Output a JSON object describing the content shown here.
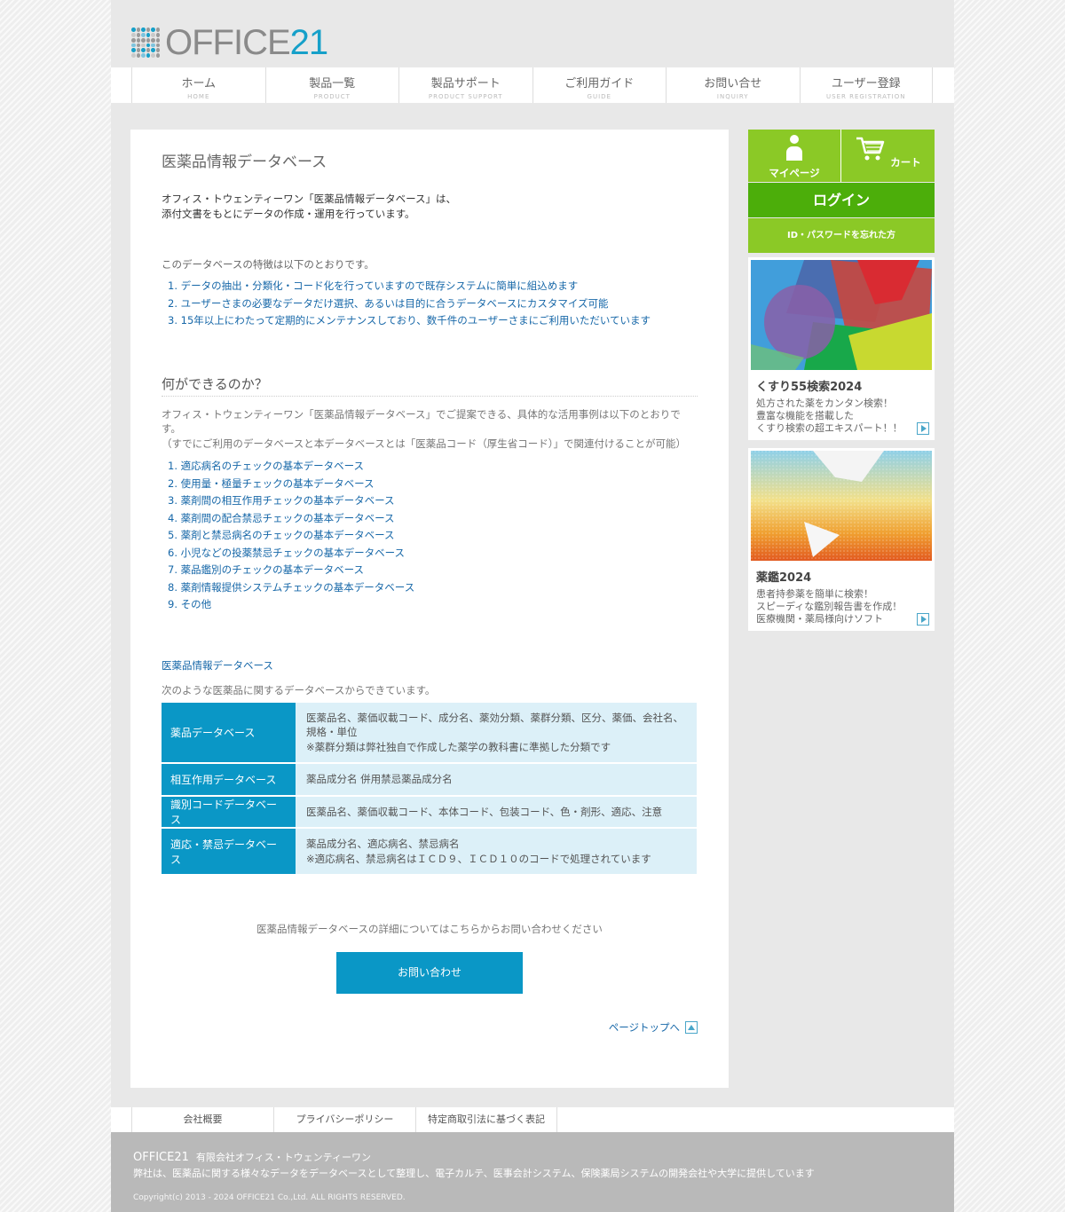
{
  "header": {
    "logo": {
      "text": "OFFICE",
      "num": "21"
    }
  },
  "nav": [
    {
      "label": "ホーム",
      "sub": "HOME"
    },
    {
      "label": "製品一覧",
      "sub": "PRODUCT"
    },
    {
      "label": "製品サポート",
      "sub": "PRODUCT SUPPORT"
    },
    {
      "label": "ご利用ガイド",
      "sub": "GUIDE"
    },
    {
      "label": "お問い合せ",
      "sub": "INQUIRY"
    },
    {
      "label": "ユーザー登録",
      "sub": "USER REGISTRATION"
    }
  ],
  "main": {
    "title": "医薬品情報データベース",
    "intro_line1": "オフィス・トウェンティーワン「医薬品情報データベース」は、",
    "intro_line2": "添付文書をもとにデータの作成・運用を行っています。",
    "features_lead": "このデータベースの特徴は以下のとおりです。",
    "features": [
      "1. データの抽出・分類化・コード化を行っていますので既存システムに簡単に組込めます",
      "2. ユーザーさまの必要なデータだけ選択、あるいは目的に合うデータベースにカスタマイズ可能",
      "3. 15年以上にわたって定期的にメンテナンスしており、数千件のユーザーさまにご利用いただいています"
    ],
    "can_title": "何ができるのか？",
    "can_desc1": "オフィス・トウェンティーワン「医薬品情報データベース」でご提案できる、具体的な活用事例は以下のとおりです。",
    "can_desc2": "（すでにご利用のデータベースと本データベースとは「医薬品コード（厚生省コード）」で関連付けることが可能）",
    "uses": [
      "1. 適応病名のチェックの基本データベース",
      "2. 使用量・極量チェックの基本データベース",
      "3. 薬剤間の相互作用チェックの基本データベース",
      "4. 薬剤間の配合禁忌チェックの基本データベース",
      "5. 薬剤と禁忌病名のチェックの基本データベース",
      "6. 小児などの投薬禁忌チェックの基本データベース",
      "7. 薬品鑑別のチェックの基本データベース",
      "8. 薬剤情報提供システムチェックの基本データベース",
      "9. その他"
    ],
    "db_link": "医薬品情報データベース",
    "db_lead": "次のような医薬品に関するデータベースからできています。",
    "db_table": [
      {
        "name": "薬品データベース",
        "line1": "医薬品名、薬価収載コード、成分名、薬効分類、薬群分類、区分、薬価、会社名、規格・単位",
        "line2": "※薬群分類は弊社独自で作成した薬学の教科書に準拠した分類です"
      },
      {
        "name": "相互作用データベース",
        "line1": "薬品成分名 併用禁忌薬品成分名",
        "line2": ""
      },
      {
        "name": "識別コードデータベース",
        "line1": "医薬品名、薬価収載コード、本体コード、包装コード、色・剤形、適応、注意",
        "line2": ""
      },
      {
        "name": "適応・禁忌データベース",
        "line1": "薬品成分名、適応病名、禁忌病名",
        "line2": "※適応病名、禁忌病名はＩＣＤ９、ＩＣＤ１０のコードで処理されています"
      }
    ],
    "contact_lead": "医薬品情報データベースの詳細についてはこちらからお問い合わせください",
    "contact_button": "お問い合わせ",
    "pagetop": "ページトップへ"
  },
  "side": {
    "mypage": "マイページ",
    "cart": "カート",
    "login": "ログイン",
    "forgot": "ID・パスワードを忘れた方",
    "banners": [
      {
        "title": "くすり55検索2024",
        "lines": [
          "処方された薬をカンタン検索！",
          "豊富な機能を搭載した",
          "くすり検索の超エキスパート！！"
        ]
      },
      {
        "title": "薬鑑2024",
        "lines": [
          "患者持参薬を簡単に検索！",
          "スピーディな鑑別報告書を作成！",
          "医療機関・薬局様向けソフト"
        ]
      }
    ]
  },
  "footer": {
    "links": [
      "会社概要",
      "プライバシーポリシー",
      "特定商取引法に基づく表記"
    ],
    "brand": "OFFICE21",
    "company": "有限会社オフィス・トウェンティーワン",
    "about": "弊社は、医薬品に関する様々なデータをデータベースとして整理し、電子カルテ、医事会計システム、保険薬局システムの開発会社や大学に提供しています",
    "copyright": "Copyright(c) 2013 - 2024 OFFICE21 Co.,Ltd. ALL RIGHTS RESERVED."
  },
  "colors": {
    "accent": "#0a97c6",
    "green": "#8bc926",
    "login_green": "#4cae0a",
    "link": "#1667a8"
  }
}
